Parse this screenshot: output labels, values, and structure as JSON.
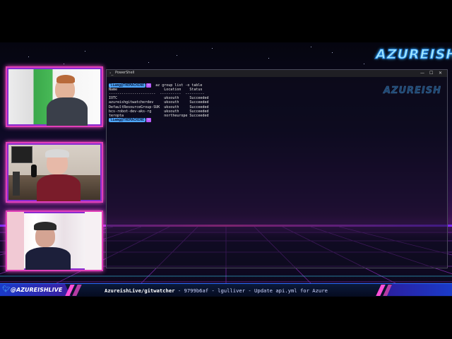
{
  "overlay": {
    "logo_text": "AZUREISH",
    "twitter_handle": "@AZUREISHLIVE",
    "twitter_icon": "twitter-icon"
  },
  "terminal": {
    "window_title": "PowerShell",
    "window_controls": [
      "—",
      "☐",
      "✕"
    ],
    "prompt_user": "liamg@THEMACHINE",
    "prompt_arrow": "~",
    "command": "az group list -o table",
    "table": {
      "columns": [
        "Name",
        "Location",
        "Status"
      ],
      "separator": "----------------------  ----------  ---------",
      "rows": [
        [
          "IOTC",
          "uksouth",
          "Succeeded"
        ],
        [
          "azureishgitwatcherdev",
          "uksouth",
          "Succeeded"
        ],
        [
          "DefaultResourceGroup-SUK",
          "uksouth",
          "Succeeded"
        ],
        [
          "bcs-robot-dev-aks-rg",
          "uksouth",
          "Succeeded"
        ],
        [
          "teropta",
          "northeurope",
          "Succeeded"
        ]
      ]
    },
    "watermark": "AZUREISH"
  },
  "ticker": {
    "repo": "AzureishLive/gitwatcher",
    "details": " - 9799b6af - lgulliver - Update api.yml for Azure"
  },
  "colors": {
    "accent_pink": "#e13fb8",
    "accent_blue": "#4fa8ff",
    "prompt_purple": "#b85cff"
  }
}
